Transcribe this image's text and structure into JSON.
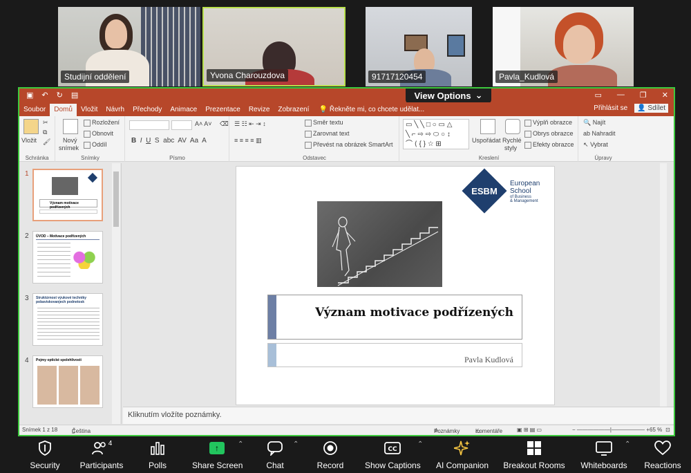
{
  "participants": [
    {
      "name": "Studijní oddělení"
    },
    {
      "name": "Yvona Charouzdova"
    },
    {
      "name": "91717120454"
    },
    {
      "name": "Pavla_Kudlová"
    }
  ],
  "share": {
    "view_options": "View Options",
    "ribbon_tabs": [
      "Soubor",
      "Domů",
      "Vložit",
      "Návrh",
      "Přechody",
      "Animace",
      "Prezentace",
      "Revize",
      "Zobrazení"
    ],
    "tell_me": "Řekněte mi, co chcete udělat...",
    "sign_in": "Přihlásit se",
    "share_btn": "Sdílet",
    "groups": {
      "clipboard": {
        "label": "Schránka",
        "paste": "Vložit"
      },
      "slides": {
        "label": "Snímky",
        "new": "Nový",
        "new2": "snímek",
        "layout": "Rozložení",
        "reset": "Obnovit",
        "section": "Oddíl"
      },
      "font": {
        "label": "Písmo"
      },
      "paragraph": {
        "label": "Odstavec",
        "direction": "Směr textu",
        "align": "Zarovnat text",
        "smartart": "Převést na obrázek SmartArt"
      },
      "drawing": {
        "label": "Kreslení",
        "arrange": "Uspořádat",
        "quick": "Rychlé",
        "quick2": "styly",
        "fill": "Výplň obrazce",
        "outline": "Obrys obrazce",
        "effects": "Efekty obrazce"
      },
      "editing": {
        "label": "Úpravy",
        "find": "Najít",
        "replace": "Nahradit",
        "select": "Vybrat"
      }
    },
    "thumb_numbers": [
      "1",
      "2",
      "3",
      "4"
    ],
    "thumb_titles": [
      "Význam motivace podřízených",
      "ÚVOD – Motivace podřízených",
      "Struktúrnost výukové techniky pobaviskovanjech podnetosk",
      "Pojmy optické spolehlivosti"
    ],
    "slide": {
      "logo_abbr": "ESBM",
      "logo_line1": "European",
      "logo_line2": "School",
      "logo_line3": "of Business",
      "logo_line4": "& Management",
      "title": "Význam motivace podřízených",
      "subtitle": "Pavla Kudlová"
    },
    "notes_placeholder": "Kliknutím vložíte poznámky.",
    "status": {
      "slide": "Snímek 1 z 18",
      "lang": "Čeština",
      "notes": "Poznámky",
      "comments": "Komentáře",
      "zoom": "65 %"
    }
  },
  "toolbar": [
    {
      "label": "Security",
      "icon": "shield-icon"
    },
    {
      "label": "Participants",
      "icon": "participants-icon",
      "count": "4"
    },
    {
      "label": "Polls",
      "icon": "polls-icon"
    },
    {
      "label": "Share Screen",
      "icon": "share-screen-icon"
    },
    {
      "label": "Chat",
      "icon": "chat-icon"
    },
    {
      "label": "Record",
      "icon": "record-icon"
    },
    {
      "label": "Show Captions",
      "icon": "captions-icon"
    },
    {
      "label": "AI Companion",
      "icon": "ai-companion-icon"
    },
    {
      "label": "Breakout Rooms",
      "icon": "breakout-rooms-icon"
    },
    {
      "label": "Whiteboards",
      "icon": "whiteboards-icon"
    },
    {
      "label": "Reactions",
      "icon": "reactions-icon"
    }
  ],
  "colors": {
    "accent": "#b7472a",
    "share_border": "#3dc93d",
    "speaker_border": "#b8e04b"
  }
}
